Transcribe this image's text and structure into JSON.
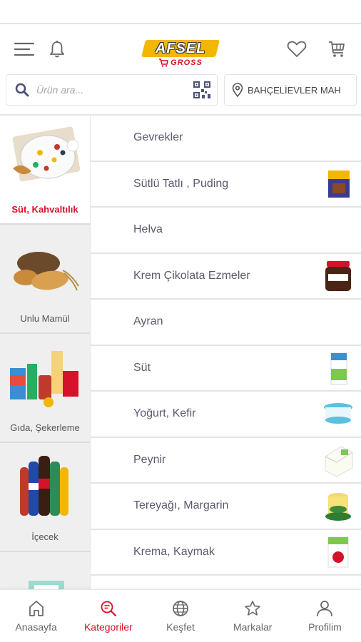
{
  "brand": {
    "name": "AFSEL",
    "sub": "GROSS",
    "yellow": "#f2b705",
    "red": "#d6112a"
  },
  "header": {
    "menu_icon": "hamburger-menu-icon",
    "bell_icon": "bell-icon",
    "heart_icon": "heart-icon",
    "cart_icon": "cart-icon"
  },
  "search": {
    "placeholder": "Ürün ara...",
    "search_icon": "search-icon",
    "qr_icon": "qr-code-icon"
  },
  "location": {
    "icon": "location-pin-icon",
    "label": "BAHÇELİEVLER MAH"
  },
  "categories": [
    {
      "label": "Süt, Kahvaltılık",
      "active": true
    },
    {
      "label": "Unlu Mamül"
    },
    {
      "label": "Gıda, Şekerleme"
    },
    {
      "label": "İçecek"
    },
    {
      "label": ""
    }
  ],
  "subcategories": [
    {
      "label": "Gevrekler"
    },
    {
      "label": "Sütlü Tatlı , Puding"
    },
    {
      "label": "Helva"
    },
    {
      "label": "Krem Çikolata Ezmeler"
    },
    {
      "label": "Ayran"
    },
    {
      "label": "Süt"
    },
    {
      "label": "Yoğurt, Kefir"
    },
    {
      "label": "Peynir"
    },
    {
      "label": "Tereyağı, Margarin"
    },
    {
      "label": "Krema, Kaymak"
    },
    {
      "label": ""
    }
  ],
  "bottom_nav": [
    {
      "label": "Anasayfa",
      "icon": "home-icon"
    },
    {
      "label": "Kategoriler",
      "icon": "categories-search-icon",
      "active": true
    },
    {
      "label": "Keşfet",
      "icon": "globe-icon"
    },
    {
      "label": "Markalar",
      "icon": "star-icon"
    },
    {
      "label": "Profilim",
      "icon": "user-icon"
    }
  ]
}
